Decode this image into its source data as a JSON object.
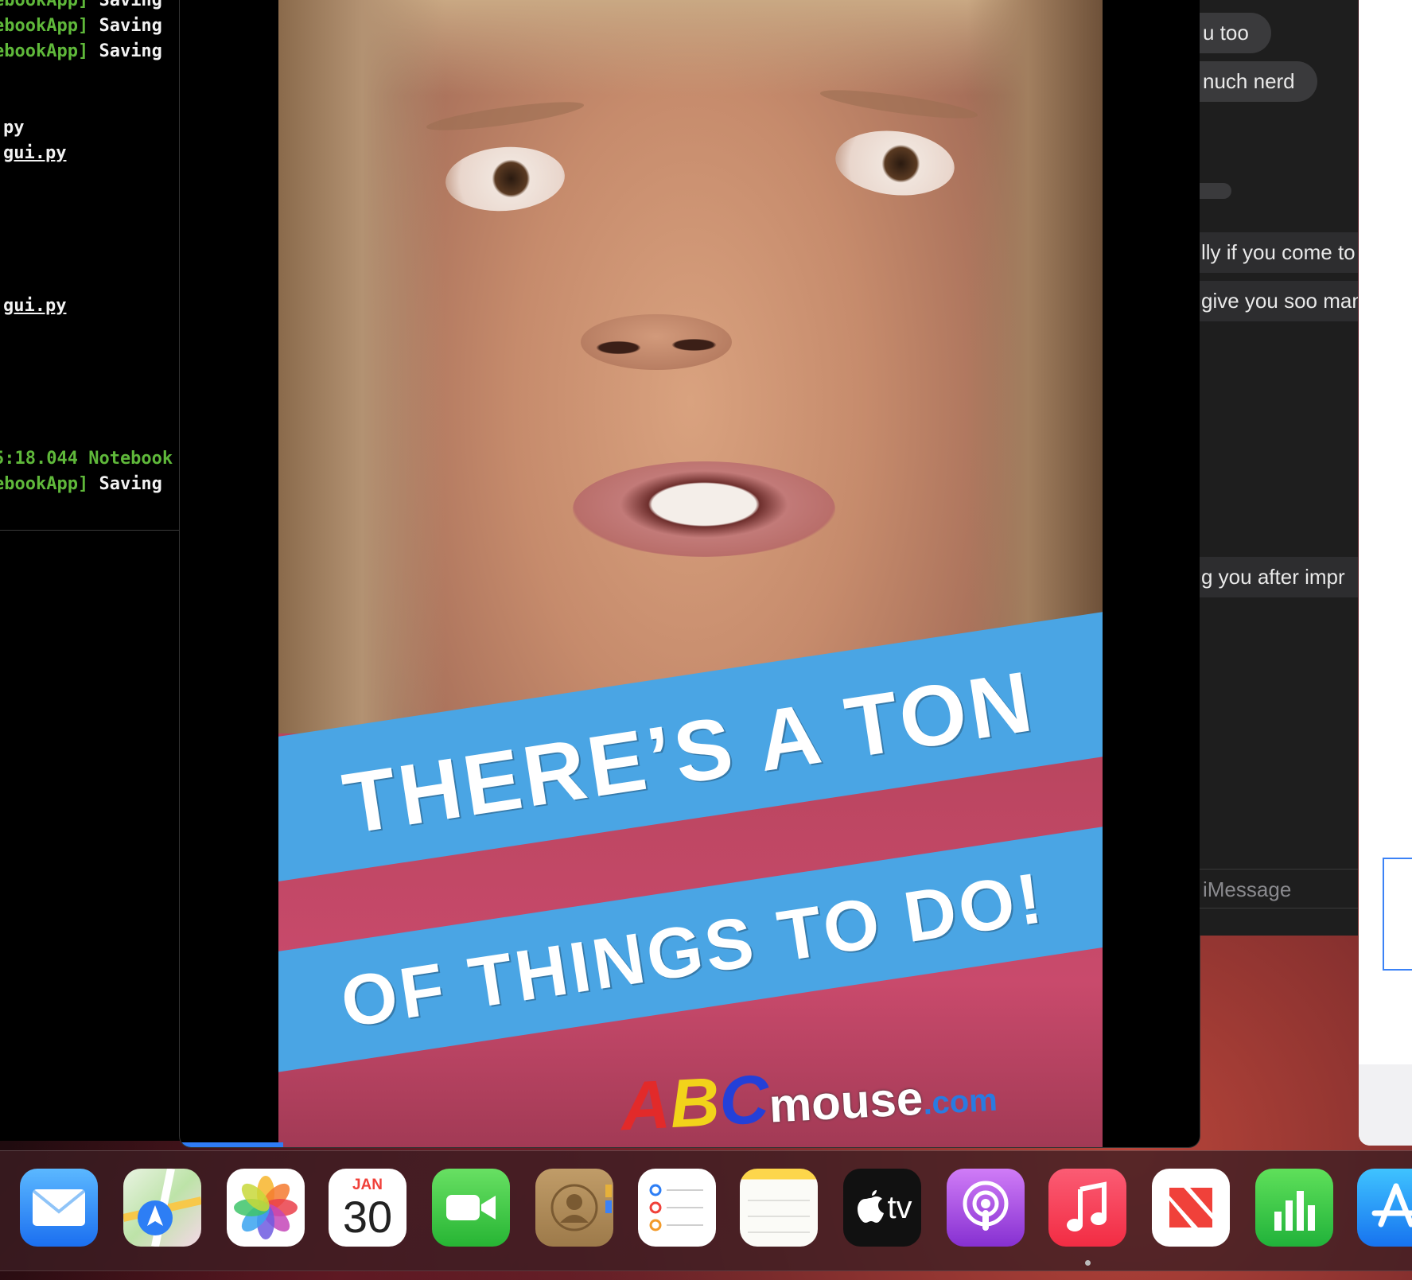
{
  "terminal": {
    "lines": [
      {
        "prefix": "ebookApp] ",
        "text": "Saving",
        "underline": false
      },
      {
        "prefix": "ebookApp] ",
        "text": "Saving",
        "underline": false
      },
      {
        "prefix": "ebookApp] ",
        "text": "Saving",
        "underline": false
      },
      {
        "prefix": "",
        "text": "py",
        "underline": false
      },
      {
        "prefix": "",
        "text": "gui.py",
        "underline": true
      },
      {
        "prefix": "",
        "text": "gui.py",
        "underline": true
      },
      {
        "prefix": "5:18.044 Notebook",
        "text": "",
        "underline": false
      },
      {
        "prefix": "ebookApp] ",
        "text": "Saving",
        "underline": false
      }
    ]
  },
  "video": {
    "banner_line1": "THERE’S A TON",
    "banner_line2": "OF THINGS TO DO!",
    "logo": {
      "a": "A",
      "b": "B",
      "c": "C",
      "mouse": "mouse",
      "domain": ".com"
    }
  },
  "messages": {
    "bubbles": [
      "u too",
      "nuch nerd"
    ],
    "flat": [
      "lly if you come to",
      "give you soo man",
      "g you after impr"
    ],
    "input_placeholder": "iMessage"
  },
  "dock": {
    "apps": [
      {
        "name": "Mail",
        "icon": "mail-icon"
      },
      {
        "name": "Maps",
        "icon": "maps-icon"
      },
      {
        "name": "Photos",
        "icon": "photos-icon"
      },
      {
        "name": "Calendar",
        "icon": "calendar-icon",
        "month": "JAN",
        "day": "30"
      },
      {
        "name": "FaceTime",
        "icon": "facetime-icon"
      },
      {
        "name": "Contacts",
        "icon": "contacts-icon"
      },
      {
        "name": "Reminders",
        "icon": "reminders-icon"
      },
      {
        "name": "Notes",
        "icon": "notes-icon"
      },
      {
        "name": "TV",
        "icon": "apple-tv-icon",
        "label": "tv"
      },
      {
        "name": "Podcasts",
        "icon": "podcasts-icon"
      },
      {
        "name": "Music",
        "icon": "music-icon"
      },
      {
        "name": "News",
        "icon": "news-icon"
      },
      {
        "name": "Numbers",
        "icon": "numbers-icon"
      },
      {
        "name": "App Store",
        "icon": "app-store-icon"
      }
    ]
  },
  "colors": {
    "banner": "#4aa5e4",
    "terminal_green": "#5fb83a",
    "imessage_bubble": "#3a3a3c"
  }
}
